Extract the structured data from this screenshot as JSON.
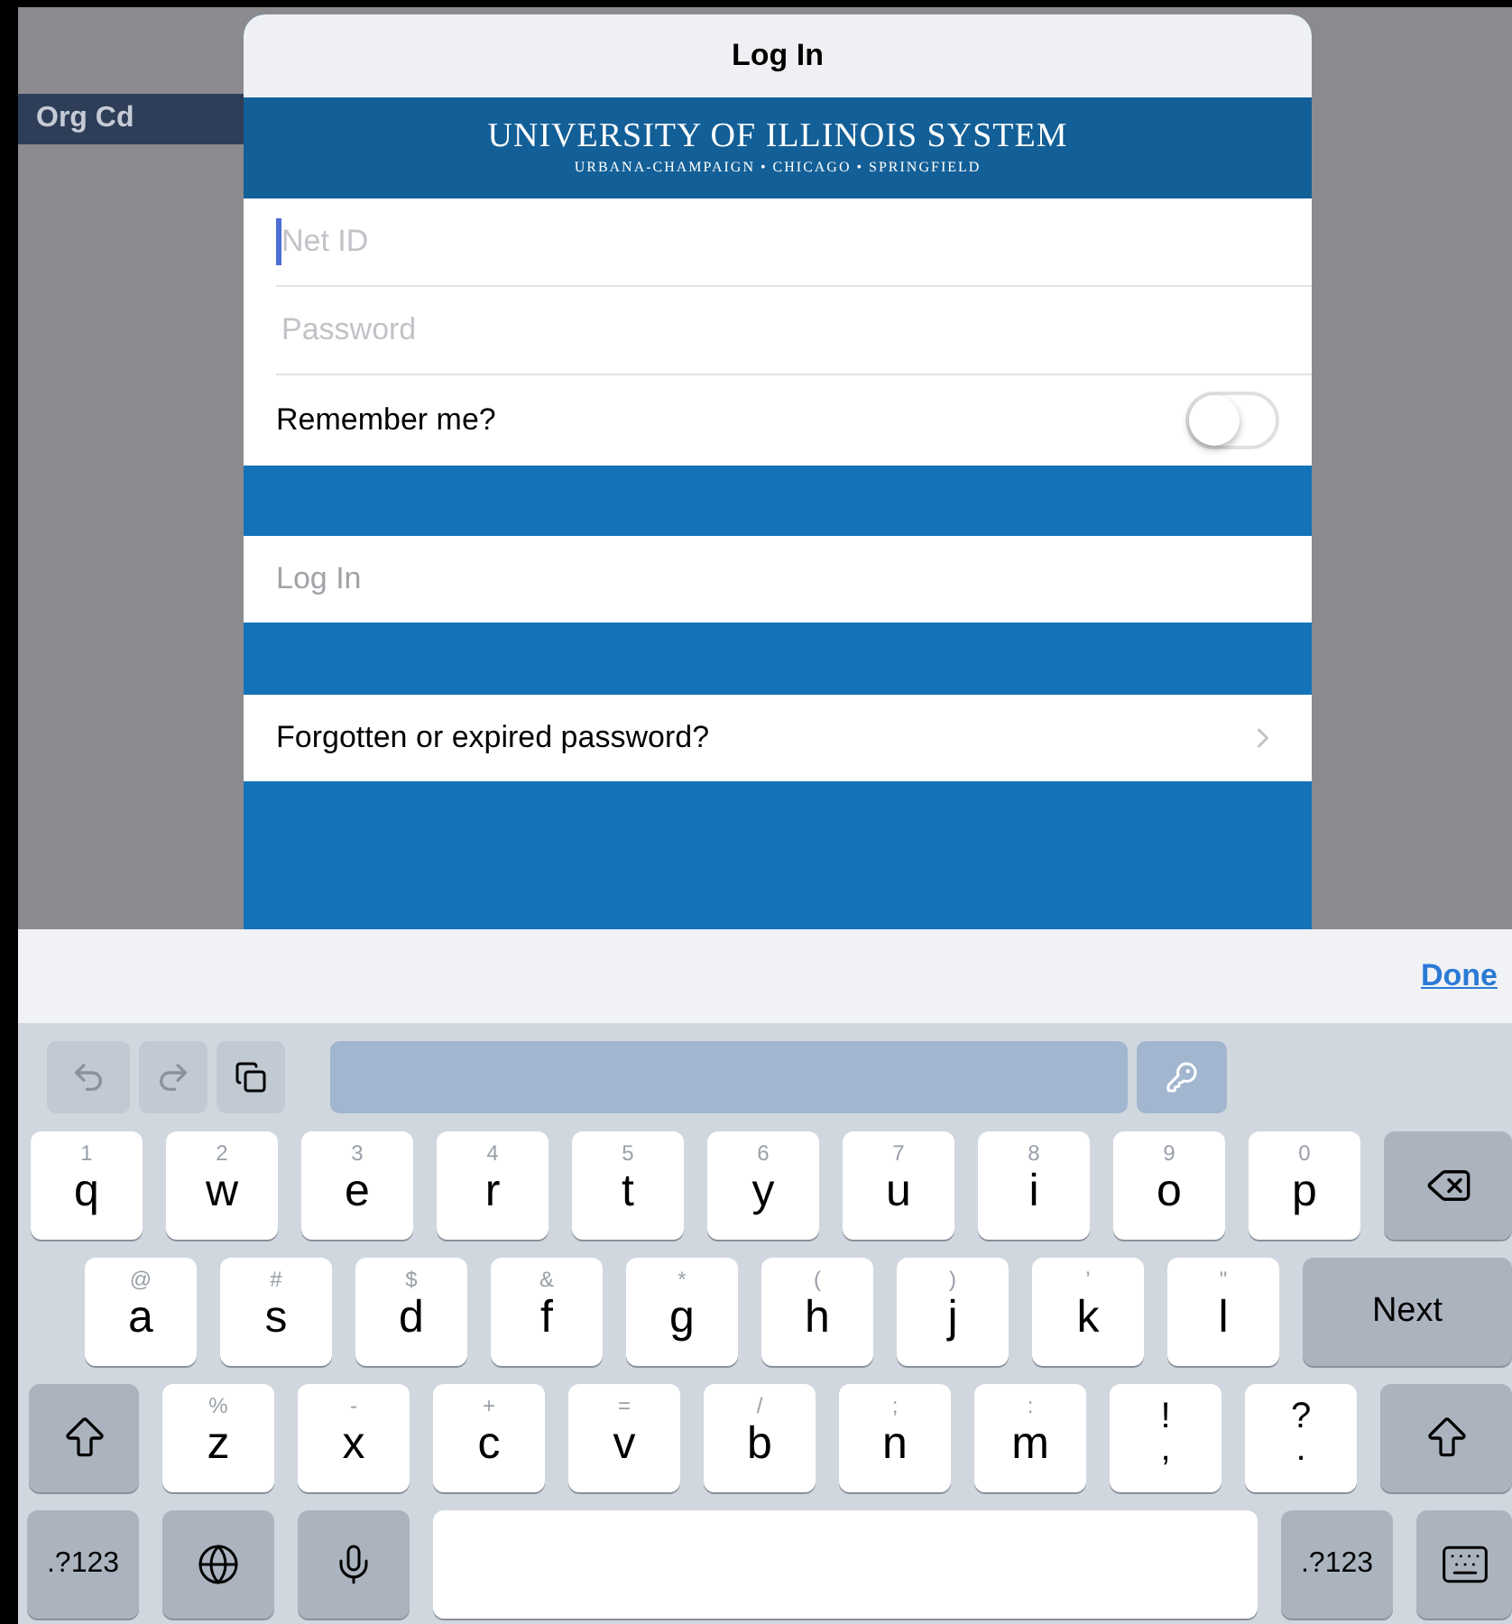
{
  "background": {
    "org_label": "Org Cd"
  },
  "dialog": {
    "title": "Log In",
    "banner": {
      "title": "UNIVERSITY OF ILLINOIS SYSTEM",
      "subtitle": "URBANA-CHAMPAIGN • CHICAGO • SPRINGFIELD"
    },
    "fields": [
      {
        "placeholder": "Net ID",
        "focused": true
      },
      {
        "placeholder": "Password",
        "focused": false
      }
    ],
    "remember": {
      "label": "Remember me?",
      "on": false
    },
    "login_button": "Log In",
    "forgot_link": "Forgotten or expired password?"
  },
  "keyboard": {
    "done": "Done",
    "rows": [
      [
        {
          "kind": "letter",
          "hint": "1",
          "label": "q"
        },
        {
          "kind": "letter",
          "hint": "2",
          "label": "w"
        },
        {
          "kind": "letter",
          "hint": "3",
          "label": "e"
        },
        {
          "kind": "letter",
          "hint": "4",
          "label": "r"
        },
        {
          "kind": "letter",
          "hint": "5",
          "label": "t"
        },
        {
          "kind": "letter",
          "hint": "6",
          "label": "y"
        },
        {
          "kind": "letter",
          "hint": "7",
          "label": "u"
        },
        {
          "kind": "letter",
          "hint": "8",
          "label": "i"
        },
        {
          "kind": "letter",
          "hint": "9",
          "label": "o"
        },
        {
          "kind": "letter",
          "hint": "0",
          "label": "p"
        },
        {
          "kind": "delete"
        }
      ],
      [
        {
          "kind": "letter",
          "hint": "@",
          "label": "a"
        },
        {
          "kind": "letter",
          "hint": "#",
          "label": "s"
        },
        {
          "kind": "letter",
          "hint": "$",
          "label": "d"
        },
        {
          "kind": "letter",
          "hint": "&",
          "label": "f"
        },
        {
          "kind": "letter",
          "hint": "*",
          "label": "g"
        },
        {
          "kind": "letter",
          "hint": "(",
          "label": "h"
        },
        {
          "kind": "letter",
          "hint": ")",
          "label": "j"
        },
        {
          "kind": "letter",
          "hint": "’",
          "label": "k"
        },
        {
          "kind": "letter",
          "hint": "\"",
          "label": "l"
        },
        {
          "kind": "action",
          "label": "Next"
        }
      ],
      [
        {
          "kind": "shift"
        },
        {
          "kind": "letter",
          "hint": "%",
          "label": "z"
        },
        {
          "kind": "letter",
          "hint": "-",
          "label": "x"
        },
        {
          "kind": "letter",
          "hint": "+",
          "label": "c"
        },
        {
          "kind": "letter",
          "hint": "=",
          "label": "v"
        },
        {
          "kind": "letter",
          "hint": "/",
          "label": "b"
        },
        {
          "kind": "letter",
          "hint": ";",
          "label": "n"
        },
        {
          "kind": "letter",
          "hint": ":",
          "label": "m"
        },
        {
          "kind": "punct",
          "hint": "!",
          "label": ","
        },
        {
          "kind": "punct",
          "hint": "?",
          "label": "."
        },
        {
          "kind": "shift"
        }
      ],
      [
        {
          "kind": "mode",
          "label": ".?123"
        },
        {
          "kind": "globe"
        },
        {
          "kind": "mic"
        },
        {
          "kind": "space"
        },
        {
          "kind": "mode",
          "label": ".?123"
        },
        {
          "kind": "hide"
        }
      ]
    ]
  }
}
